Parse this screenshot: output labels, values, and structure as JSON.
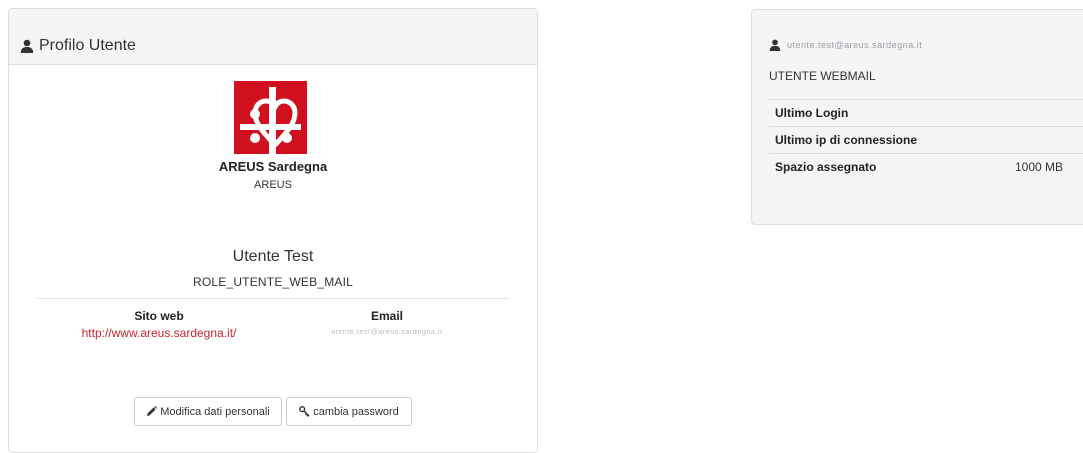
{
  "profile_panel": {
    "title": "Profilo Utente",
    "title_icon": "user-icon",
    "logo_color": "#d0101f",
    "org_name": "AREUS Sardegna",
    "org_short": "AREUS",
    "user_name": "Utente Test",
    "user_role": "ROLE_UTENTE_WEB_MAIL",
    "site_label": "Sito web",
    "site_url": "http://www.areus.sardegna.it/",
    "email_label": "Email",
    "email_value": "utente.test@areus.sardegna.it",
    "edit_button": "Modifica dati personali",
    "edit_icon": "pencil-icon",
    "password_button": "cambia password",
    "password_icon": "key-icon",
    "link_color": "#c9252e"
  },
  "summary_panel": {
    "title": "utente.test@areus.sardegna.it",
    "title_icon": "user-icon",
    "subtitle": "UTENTE WEBMAIL",
    "rows": [
      {
        "label": "Ultimo Login",
        "value": ""
      },
      {
        "label": "Ultimo ip di connessione",
        "value": ""
      },
      {
        "label": "Spazio assegnato",
        "value": "1000 MB"
      }
    ]
  }
}
